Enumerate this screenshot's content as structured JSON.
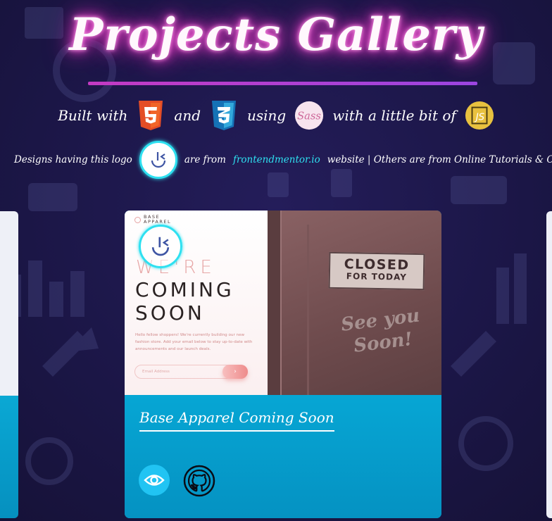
{
  "header": {
    "title": "Projects Gallery",
    "built_with": "Built with",
    "and": "and",
    "using": "using",
    "with_a_little_bit_of": "with a little bit of",
    "tech_icons": [
      "html5-icon",
      "css3-icon",
      "sass-icon",
      "javascript-icon"
    ]
  },
  "info": {
    "designs_text": "Designs having this logo",
    "are_from": "are from",
    "link_text": "frontendmentor.io",
    "rest": "website | Others are from Online Tutorials & Courses"
  },
  "card": {
    "title": "Base Apparel Coming Soon",
    "preview": {
      "brand": "BASE\nAPPAREL",
      "were": "WE'RE",
      "coming": "COMING",
      "soon": "SOON",
      "description": "Hello fellow shoppers! We're currently building our new fashion store. Add your email below to stay up-to-date with announcements and our launch deals.",
      "email_placeholder": "Email Address",
      "go_arrow": "›",
      "sign_line1": "CLOSED",
      "sign_line2": "FOR TODAY",
      "see_you": "See you",
      "soon_script": "Soon!"
    },
    "actions": [
      "eye-icon",
      "github-icon"
    ]
  },
  "colors": {
    "background": "#1b1646",
    "title_glow": "#f24bd0",
    "underline": "#b03cc9",
    "accent_cyan": "#2ee0f0",
    "card_blue": "#06a3d1"
  }
}
